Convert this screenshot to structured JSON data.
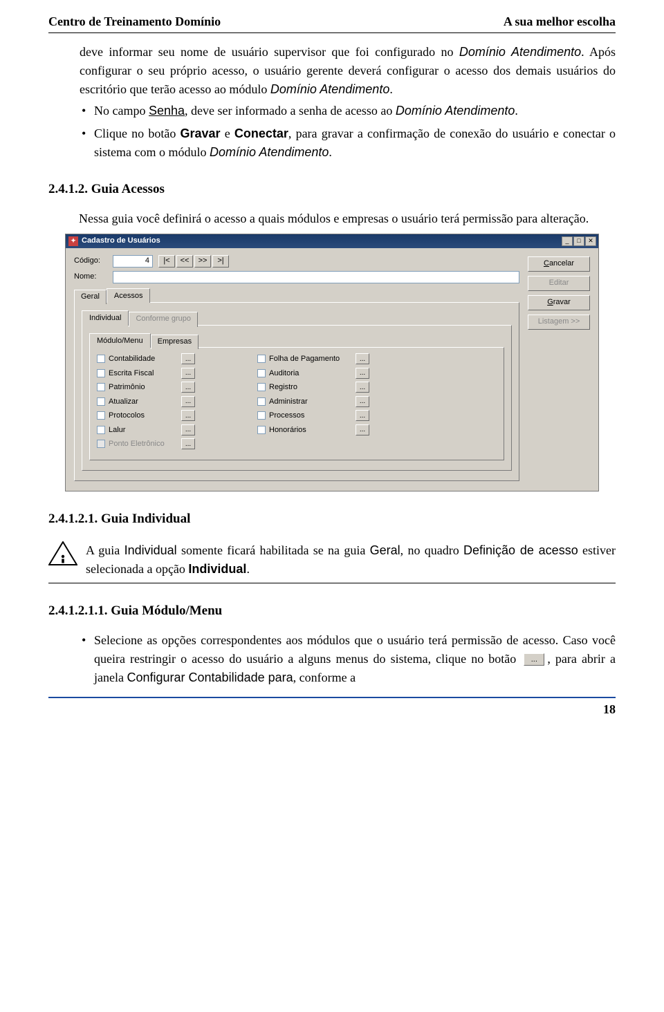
{
  "header": {
    "left": "Centro de Treinamento Domínio",
    "right": "A sua melhor escolha"
  },
  "para1": {
    "p1a": "deve informar seu nome de usuário supervisor que foi configurado no ",
    "p1b": "Domínio Atendimento",
    "p1c": ". Após configurar o seu próprio acesso, o usuário gerente deverá configurar o acesso dos demais usuários do escritório que terão acesso ao módulo ",
    "p1d": "Domínio Atendimento",
    "p1e": "."
  },
  "bullets_top": {
    "b2a": "No campo ",
    "b2b": "Senha",
    "b2c": ", deve ser informado a senha de acesso ao ",
    "b2d": "Domínio Atendimento",
    "b2e": ".",
    "b3a": "Clique no botão ",
    "b3b": "Gravar",
    "b3c": " e ",
    "b3d": "Conectar",
    "b3e": ", para gravar a confirmação de conexão do usuário e conectar o sistema com o módulo ",
    "b3f": "Domínio Atendimento",
    "b3g": "."
  },
  "sec1_title": "2.4.1.2. Guia Acessos",
  "sec1_intro": "Nessa guia você definirá o acesso a quais módulos e empresas o usuário terá permissão para alteração.",
  "dialog": {
    "title": "Cadastro de Usuários",
    "codigo_label": "Código:",
    "codigo_value": "4",
    "nav": {
      "first": "|<",
      "prev": "<<",
      "next": ">>",
      "last": ">|"
    },
    "nome_label": "Nome:",
    "tabs_main": {
      "geral": "Geral",
      "acessos": "Acessos"
    },
    "tabs_sub1": {
      "individual": "Individual",
      "conforme_grupo": "Conforme grupo"
    },
    "tabs_sub2": {
      "modulo": "Módulo/Menu",
      "empresas": "Empresas"
    },
    "left_checks": [
      "Contabilidade",
      "Escrita Fiscal",
      "Patrimônio",
      "Atualizar",
      "Protocolos",
      "Lalur",
      "Ponto Eletrônico"
    ],
    "right_checks": [
      "Folha de Pagamento",
      "Auditoria",
      "Registro",
      "Administrar",
      "Processos",
      "Honorários"
    ],
    "ellipsis": "...",
    "btns": {
      "cancelar": "Cancelar",
      "editar": "Editar",
      "gravar": "Gravar",
      "listagem": "Listagem >>"
    }
  },
  "sec2_title": "2.4.1.2.1. Guia Individual",
  "info": {
    "a": "A guia ",
    "b": "Individual",
    "c": " somente ficará habilitada se na guia ",
    "d": "Geral",
    "e": ", no quadro ",
    "f": "Definição de acesso",
    "g": " estiver selecionada a opção ",
    "h": "Individual",
    "i": "."
  },
  "sec3_title": "2.4.1.2.1.1. Guia Módulo/Menu",
  "sec3_bullet": {
    "a": "Selecione as opções correspondentes aos módulos que o usuário terá permissão de acesso. Caso você queira restringir o acesso do usuário a alguns menus do sistema, clique no botão ",
    "btn": "...",
    "b": ", para abrir a janela ",
    "c": "Configurar Contabilidade para",
    "d": ", conforme a"
  },
  "page_number": "18"
}
